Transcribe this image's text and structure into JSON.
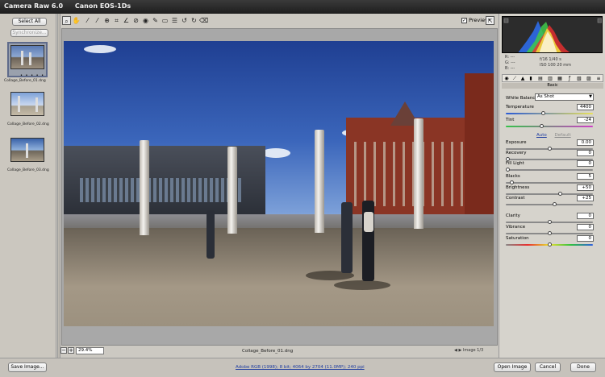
{
  "title": {
    "app": "Camera Raw 6.0",
    "camera": "Canon EOS-1Ds"
  },
  "filmstrip": {
    "select_all": "Select All",
    "synchronize": "Synchronize...",
    "items": [
      {
        "label": "Collage_Before_01.dng",
        "selected": true
      },
      {
        "label": "Collage_Before_02.dng",
        "selected": false
      },
      {
        "label": "Collage_Before_03.dng",
        "selected": false
      }
    ],
    "rating_dots": "• • • • •"
  },
  "toolbar": {
    "tools": [
      "zoom-icon",
      "hand-icon",
      "white-balance-icon",
      "color-sampler-icon",
      "target-adjust-icon",
      "crop-icon",
      "straighten-icon",
      "spot-removal-icon",
      "red-eye-icon",
      "adjustment-brush-icon",
      "graduated-filter-icon",
      "preferences-icon",
      "rotate-left-icon",
      "rotate-right-icon",
      "trash-icon"
    ],
    "preview_label": "Preview",
    "preview_checked": true
  },
  "canvas": {
    "zoom": "29.4%",
    "filename": "Collage_Before_01.dng",
    "image_counter": "Image 1/3"
  },
  "info": {
    "r": "R: ---",
    "g": "G: ---",
    "b": "B: ---",
    "aperture_shutter": "f/16   1/40 s",
    "iso_focal": "ISO 100   20 mm"
  },
  "panel": {
    "section": "Basic",
    "white_balance_label": "White Balance:",
    "white_balance_value": "As Shot",
    "auto": "Auto",
    "default": "Default",
    "sliders": [
      {
        "label": "Temperature",
        "value": "4400",
        "pos": 0.42,
        "track": "temp"
      },
      {
        "label": "Tint",
        "value": "-24",
        "pos": 0.4,
        "track": "tint"
      },
      {
        "label": "Exposure",
        "value": "0.00",
        "pos": 0.5,
        "track": "grey"
      },
      {
        "label": "Recovery",
        "value": "0",
        "pos": 0.0,
        "track": "grey"
      },
      {
        "label": "Fill Light",
        "value": "0",
        "pos": 0.0,
        "track": "grey"
      },
      {
        "label": "Blacks",
        "value": "5",
        "pos": 0.05,
        "track": "grey"
      },
      {
        "label": "Brightness",
        "value": "+50",
        "pos": 0.625,
        "track": "grey"
      },
      {
        "label": "Contrast",
        "value": "+25",
        "pos": 0.56,
        "track": "grey"
      },
      {
        "label": "Clarity",
        "value": "0",
        "pos": 0.5,
        "track": "grey"
      },
      {
        "label": "Vibrance",
        "value": "0",
        "pos": 0.5,
        "track": "grey"
      },
      {
        "label": "Saturation",
        "value": "0",
        "pos": 0.5,
        "track": "sat"
      }
    ]
  },
  "footer": {
    "save_image": "Save Image...",
    "workflow_link": "Adobe RGB (1998); 8 bit; 4064 by 2704 (11.0MP); 240 ppi",
    "open_image": "Open Image",
    "cancel": "Cancel",
    "done": "Done"
  },
  "colors": {
    "title_bg": "#2a2a2a",
    "panel_bg": "#d6d3cc",
    "link": "#1f3da0"
  }
}
